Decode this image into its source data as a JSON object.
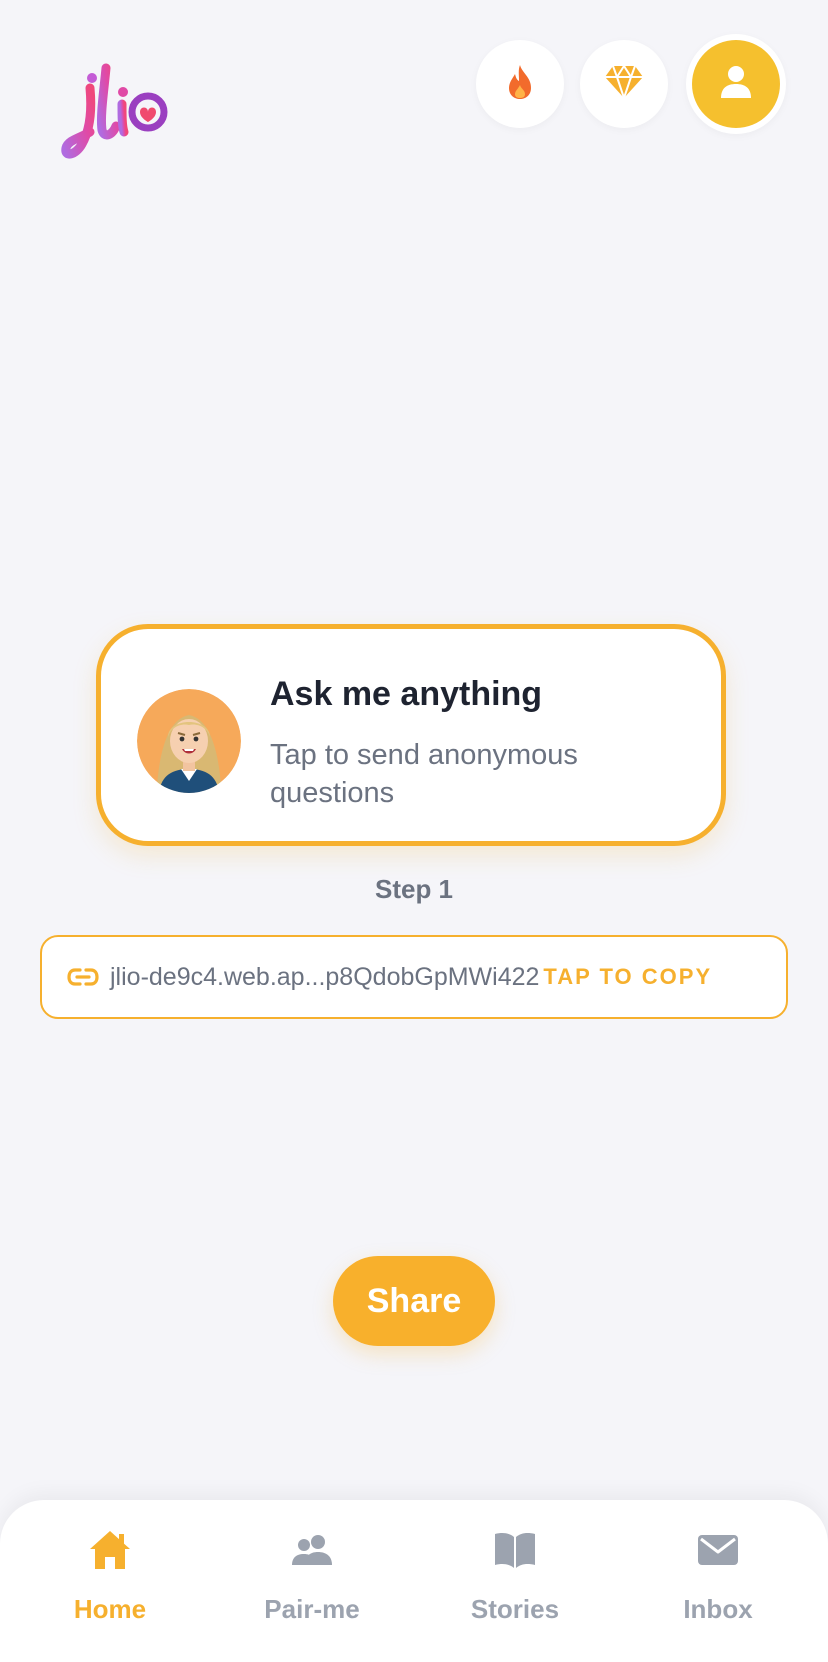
{
  "app": {
    "logo_text": "jlio"
  },
  "header": {
    "buttons": [
      {
        "name": "fire",
        "icon": "fire-icon"
      },
      {
        "name": "gem",
        "icon": "gem-icon"
      },
      {
        "name": "profile",
        "icon": "user-icon"
      }
    ]
  },
  "card": {
    "title": "Ask me anything",
    "subtitle": "Tap to send anonymous questions"
  },
  "step": {
    "label": "Step 1"
  },
  "link": {
    "url": "jlio-de9c4.web.ap...p8QdobGpMWi422",
    "copy_label": "TAP TO COPY"
  },
  "share": {
    "label": "Share"
  },
  "nav": {
    "items": [
      {
        "label": "Home",
        "icon": "home-icon",
        "active": true
      },
      {
        "label": "Pair-me",
        "icon": "users-icon",
        "active": false
      },
      {
        "label": "Stories",
        "icon": "book-icon",
        "active": false
      },
      {
        "label": "Inbox",
        "icon": "mail-icon",
        "active": false
      }
    ]
  },
  "colors": {
    "accent": "#f6b02e",
    "profile": "#f5c02e",
    "fire": "#f26b2c",
    "background": "#f5f5f9",
    "muted": "#9ca3af",
    "title": "#1e2330"
  }
}
